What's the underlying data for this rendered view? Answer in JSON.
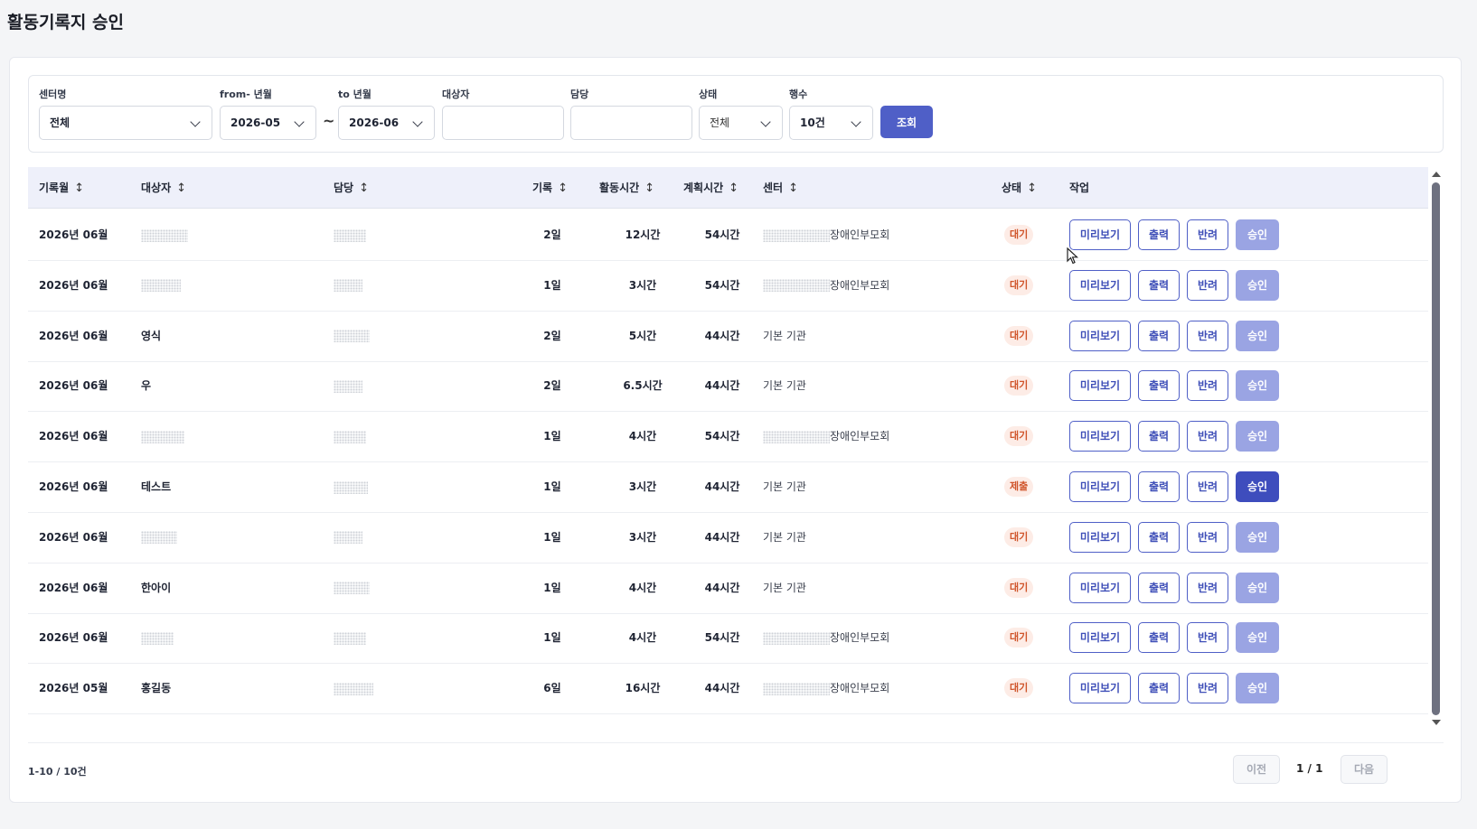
{
  "page": {
    "title": "활동기록지 승인"
  },
  "filters": {
    "center": {
      "label": "센터명",
      "value": "전체"
    },
    "from": {
      "label": "from- 년월",
      "value": "2026-05"
    },
    "range_sep": "~",
    "to": {
      "label": "to 년월",
      "value": "2026-06"
    },
    "target": {
      "label": "대상자",
      "value": ""
    },
    "manager": {
      "label": "담당",
      "value": ""
    },
    "status": {
      "label": "상태",
      "value": "전체"
    },
    "rows": {
      "label": "행수",
      "value": "10건"
    },
    "search_label": "조회"
  },
  "table": {
    "headers": {
      "month": "기록월",
      "target": "대상자",
      "manager": "담당",
      "days": "기록",
      "activity": "활동시간",
      "plan": "계획시간",
      "center": "센터",
      "status": "상태",
      "actions": "작업"
    },
    "sort_glyph": "↕",
    "actions": {
      "preview": "미리보기",
      "print": "출력",
      "reject": "반려",
      "approve": "승인"
    },
    "rows": [
      {
        "month": "2026년 06월",
        "target": "",
        "days": "2일",
        "activity": "12시간",
        "plan": "54시간",
        "center": "장애인부모회",
        "status": "대기"
      },
      {
        "month": "2026년 06월",
        "target": "",
        "days": "1일",
        "activity": "3시간",
        "plan": "54시간",
        "center": "장애인부모회",
        "status": "대기"
      },
      {
        "month": "2026년 06월",
        "target": "영식",
        "days": "2일",
        "activity": "5시간",
        "plan": "44시간",
        "center": "기본 기관",
        "status": "대기"
      },
      {
        "month": "2026년 06월",
        "target": "우",
        "days": "2일",
        "activity": "6.5시간",
        "plan": "44시간",
        "center": "기본 기관",
        "status": "대기"
      },
      {
        "month": "2026년 06월",
        "target": "",
        "days": "1일",
        "activity": "4시간",
        "plan": "54시간",
        "center": "장애인부모회",
        "status": "대기"
      },
      {
        "month": "2026년 06월",
        "target": "테스트",
        "days": "1일",
        "activity": "3시간",
        "plan": "44시간",
        "center": "기본 기관",
        "status": "제출"
      },
      {
        "month": "2026년 06월",
        "target": "",
        "days": "1일",
        "activity": "3시간",
        "plan": "44시간",
        "center": "기본 기관",
        "status": "대기"
      },
      {
        "month": "2026년 06월",
        "target": "한아이",
        "days": "1일",
        "activity": "4시간",
        "plan": "44시간",
        "center": "기본 기관",
        "status": "대기"
      },
      {
        "month": "2026년 06월",
        "target": "",
        "days": "1일",
        "activity": "4시간",
        "plan": "54시간",
        "center": "장애인부모회",
        "status": "대기"
      },
      {
        "month": "2026년 05월",
        "target": "홍길동",
        "days": "6일",
        "activity": "16시간",
        "plan": "44시간",
        "center": "장애인부모회",
        "status": "대기"
      }
    ]
  },
  "footer": {
    "total": "1-10 / 10건",
    "prev": "이전",
    "page": "1 / 1",
    "next": "다음"
  }
}
